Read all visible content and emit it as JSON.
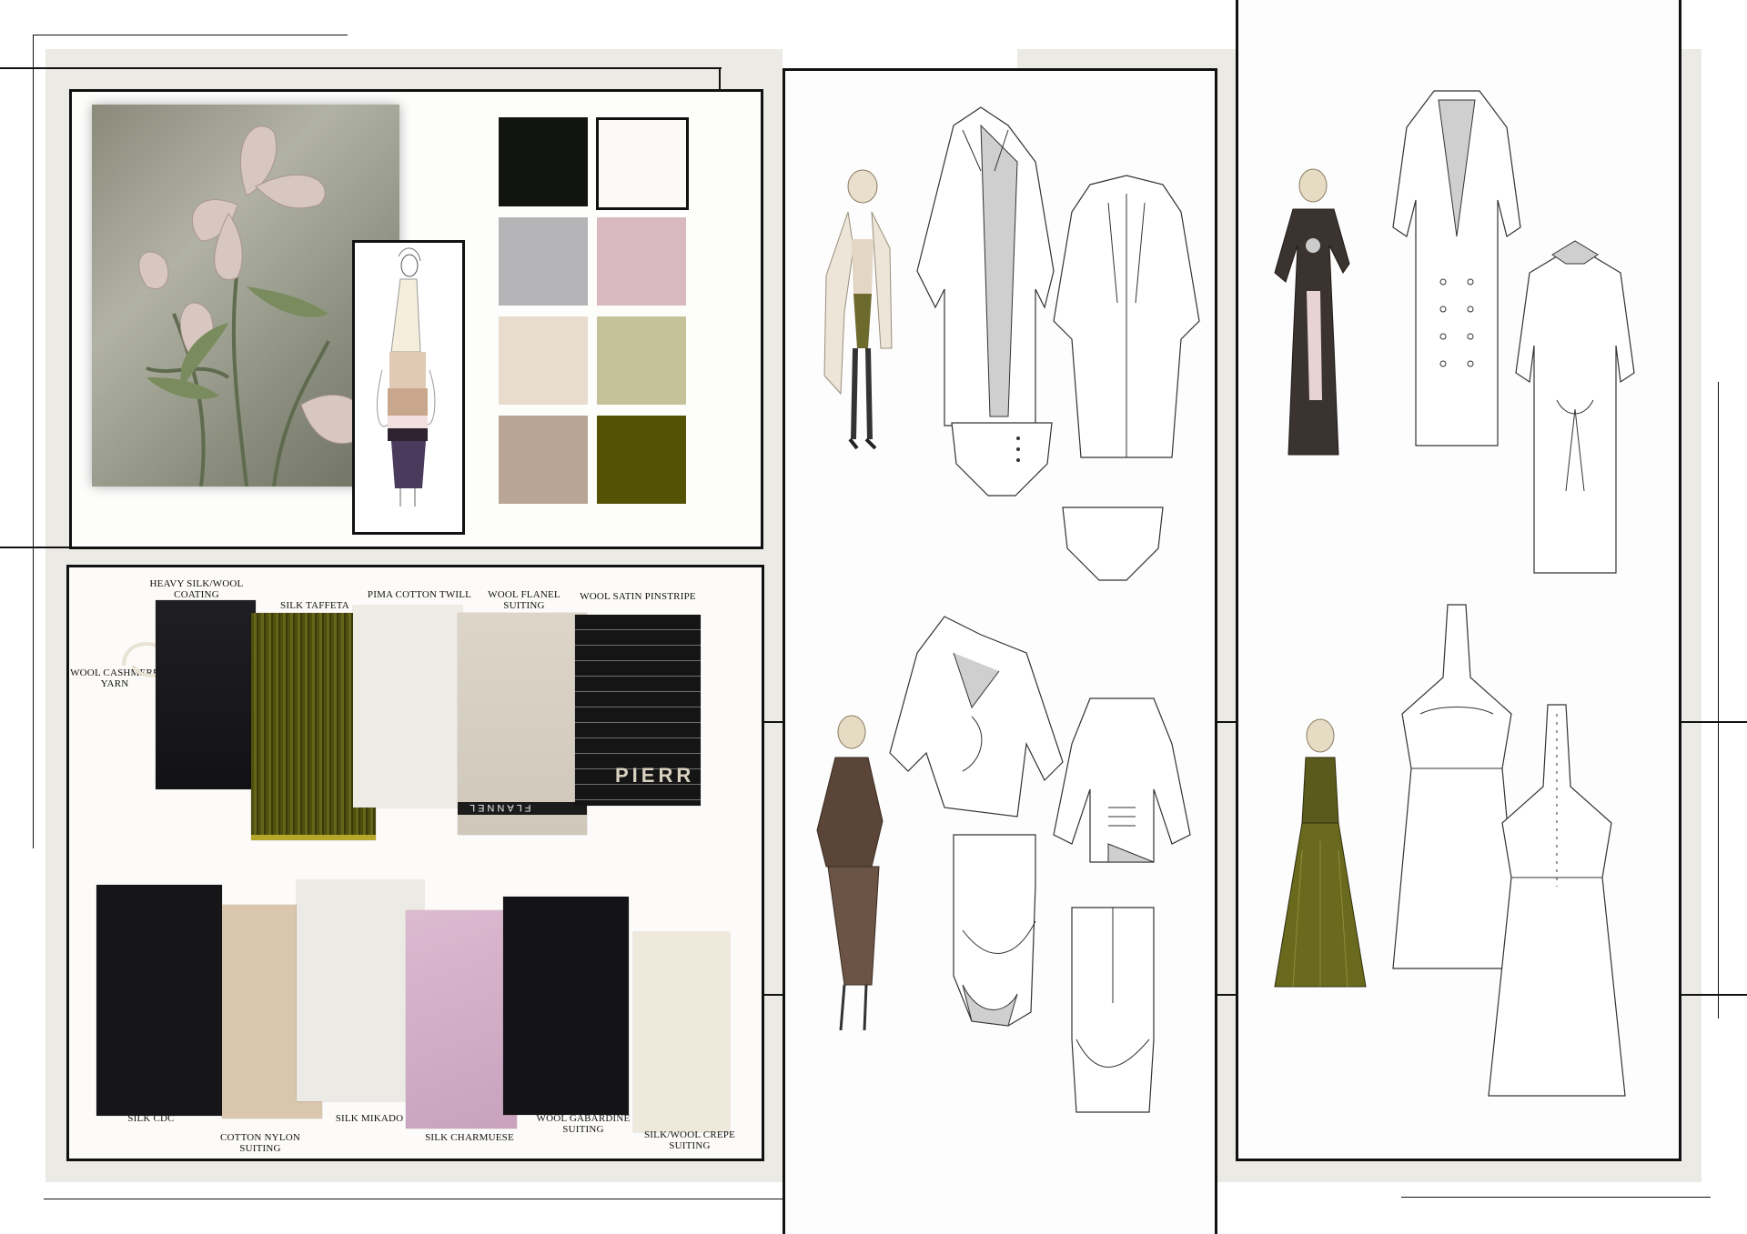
{
  "palette": {
    "swatches": [
      {
        "name": "black",
        "color": "#111410"
      },
      {
        "name": "off-white",
        "color": "#fbfaf6"
      },
      {
        "name": "grey",
        "color": "#b4b4b6"
      },
      {
        "name": "pink",
        "color": "#d8b9c2"
      },
      {
        "name": "cream",
        "color": "#e8dccc"
      },
      {
        "name": "sage",
        "color": "#c5c29a"
      },
      {
        "name": "taupe",
        "color": "#b9a595"
      },
      {
        "name": "olive",
        "color": "#545305"
      }
    ]
  },
  "fabrics": {
    "top_row": [
      {
        "label": "HEAVY SILK/WOOL COATING",
        "color": "#1b1b1d"
      },
      {
        "label": "SILK TAFFETA",
        "color": "#545411"
      },
      {
        "label": "PIMA COTTON TWILL",
        "color": "#eeece4"
      },
      {
        "label": "WOOL FLANEL SUITING",
        "color": "#d8d2c5"
      },
      {
        "label": "WOOL SATIN PINSTRIPE",
        "color": "#151515"
      }
    ],
    "yarn_label": "WOOL CASHMERE YARN",
    "bottom_row": [
      {
        "label": "SILK CDC",
        "color": "#161618"
      },
      {
        "label": "COTTON NYLON SUITING",
        "color": "#d9c6ad"
      },
      {
        "label": "SILK MIKADO",
        "color": "#ebeae4"
      },
      {
        "label": "SILK CHARMUESE",
        "color": "#d7b2cb"
      },
      {
        "label": "WOOL GABARDINE SUITING",
        "color": "#141416"
      },
      {
        "label": "SILK/WOOL CREPE SUITING",
        "color": "#efe9dc"
      }
    ],
    "pinstripe_text": "PIERR",
    "flannel_text": "FLANNEL"
  },
  "colors": {
    "frame": "#111111",
    "panel_bg": "#eceae5"
  }
}
